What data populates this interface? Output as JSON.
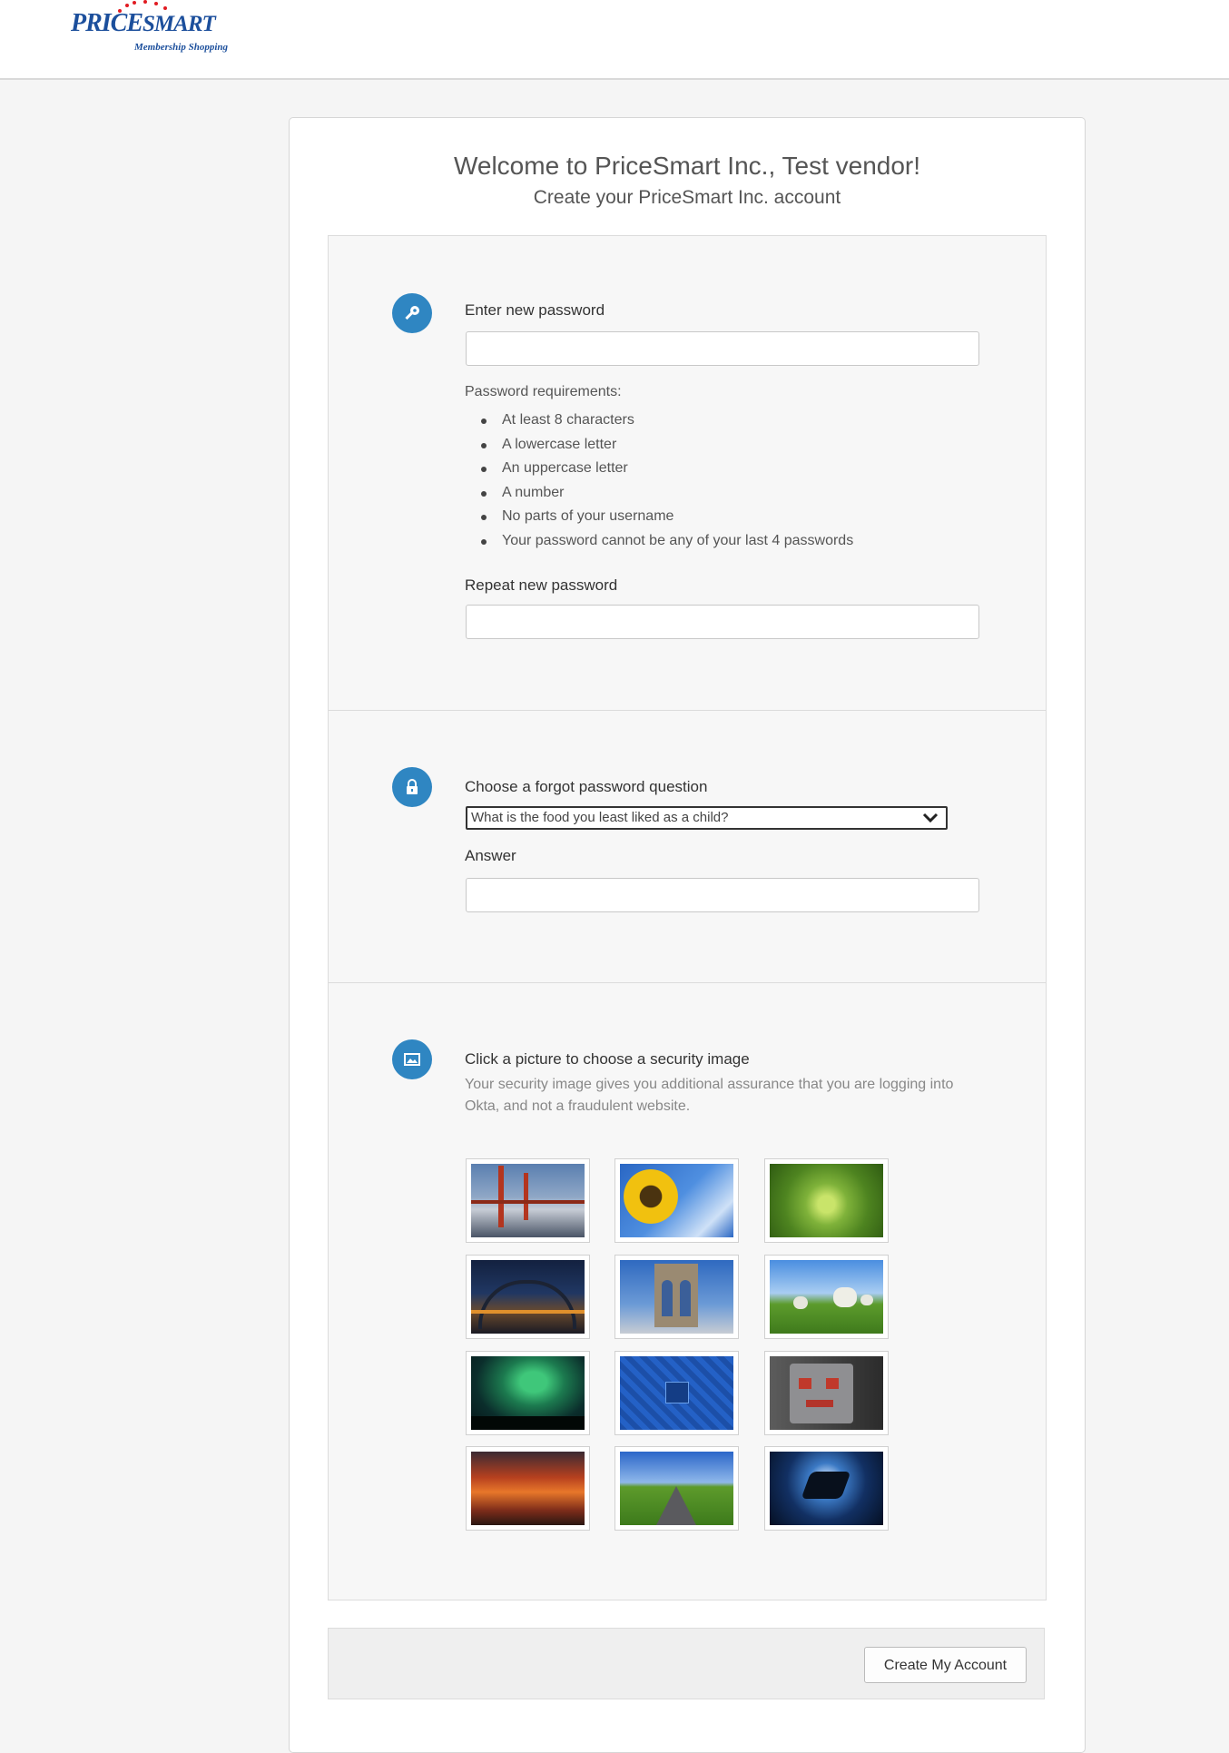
{
  "header": {
    "logo": {
      "brand_price": "PRICE",
      "brand_smart": "SMART",
      "tagline": "Membership Shopping"
    }
  },
  "card": {
    "welcome": "Welcome to PriceSmart Inc., Test vendor!",
    "subtitle": "Create your PriceSmart Inc. account"
  },
  "password_section": {
    "icon": "key-icon",
    "label": "Enter new password",
    "password_value": "",
    "requirements_title": "Password requirements:",
    "requirements": [
      "At least 8 characters",
      "A lowercase letter",
      "An uppercase letter",
      "A number",
      "No parts of your username",
      "Your password cannot be any of your last 4 passwords"
    ],
    "repeat_label": "Repeat new password",
    "repeat_value": ""
  },
  "recovery_section": {
    "icon": "lock-icon",
    "question_label": "Choose a forgot password question",
    "selected_question": "What is the food you least liked as a child?",
    "answer_label": "Answer",
    "answer_value": ""
  },
  "security_image_section": {
    "icon": "image-icon",
    "title": "Click a picture to choose a security image",
    "description": "Your security image gives you additional assurance that you are logging into Okta, and not a fraudulent website.",
    "images": [
      "golden-gate-bridge",
      "sunflower",
      "green-succulent",
      "harbour-bridge-night",
      "brooklyn-bridge",
      "lambs-in-field",
      "northern-lights",
      "blue-circuit-board",
      "robot-toy",
      "sunset-clouds",
      "country-road",
      "manta-ray"
    ]
  },
  "footer": {
    "submit_label": "Create My Account"
  }
}
